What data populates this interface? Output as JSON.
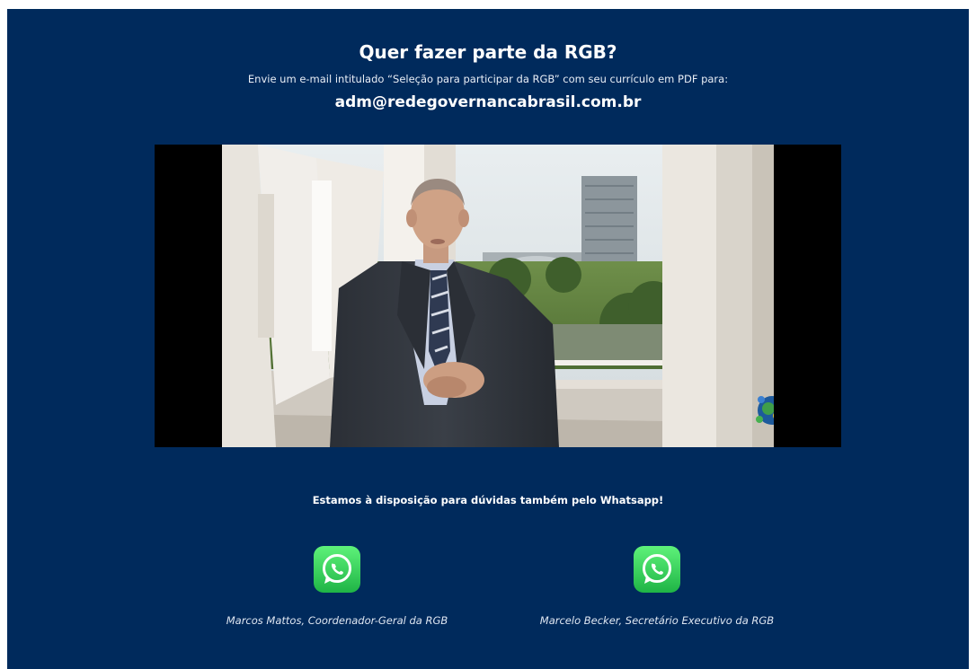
{
  "header": {
    "title": "Quer fazer parte da RGB?",
    "subtitle": "Envie um e-mail intitulado “Seleção para participar da RGB” com seu currículo em PDF para:",
    "email": "adm@redegovernancabrasil.com.br"
  },
  "video": {
    "description": "video-frame"
  },
  "whatsapp": {
    "note": "Estamos à disposição para dúvidas também pelo Whatsapp!",
    "contacts": [
      {
        "name": "Marcos Mattos, Coordenador-Geral da RGB"
      },
      {
        "name": "Marcelo Becker, Secretário Executivo da RGB"
      }
    ]
  },
  "colors": {
    "background": "#002a5c",
    "whatsapp_green": "#25d366"
  }
}
